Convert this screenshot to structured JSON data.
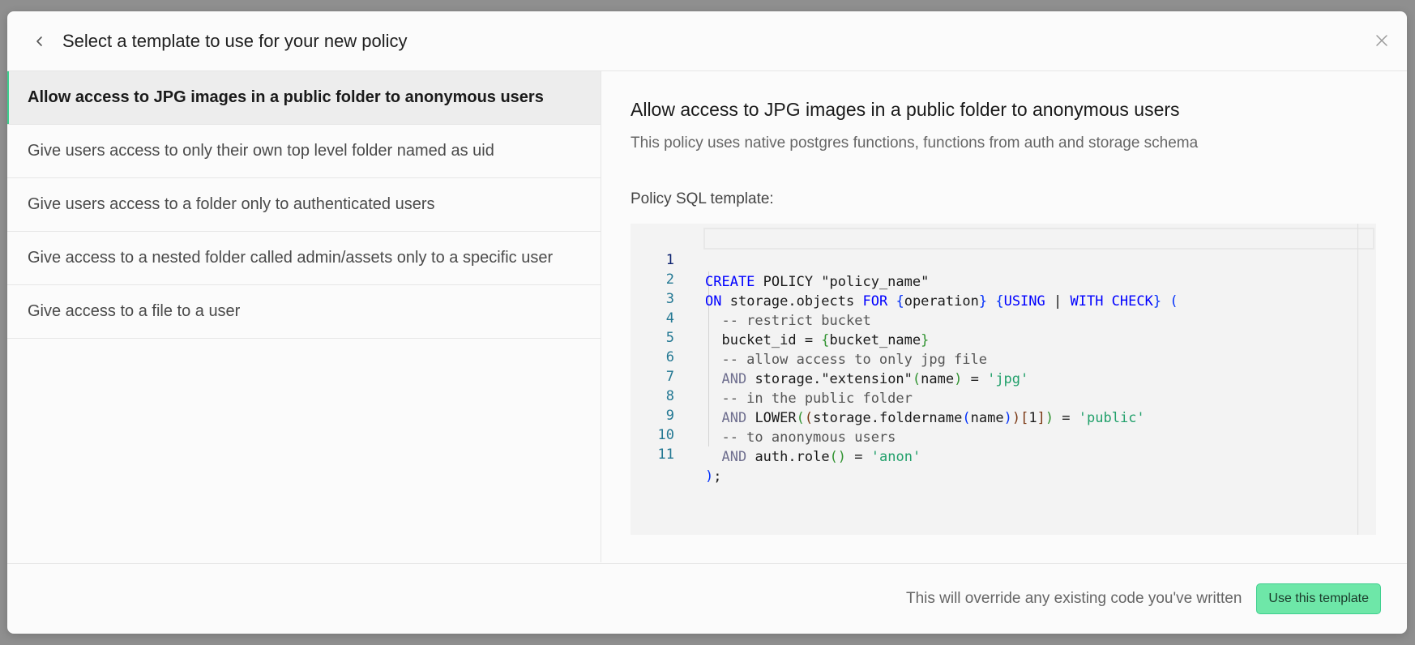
{
  "header": {
    "title": "Select a template to use for your new policy",
    "back_icon": "chevron-left-icon",
    "close_icon": "close-icon"
  },
  "templates": [
    {
      "label": "Allow access to JPG images in a public folder to anonymous users",
      "active": true
    },
    {
      "label": "Give users access to only their own top level folder named as uid",
      "active": false
    },
    {
      "label": "Give users access to a folder only to authenticated users",
      "active": false
    },
    {
      "label": "Give access to a nested folder called admin/assets only to a specific user",
      "active": false
    },
    {
      "label": "Give access to a file to a user",
      "active": false
    }
  ],
  "detail": {
    "title": "Allow access to JPG images in a public folder to anonymous users",
    "description": "This policy uses native postgres functions, functions from auth and storage schema",
    "sql_label": "Policy SQL template:"
  },
  "code_lines": [
    "CREATE POLICY \"policy_name\"",
    "ON storage.objects FOR {operation} {USING | WITH CHECK} (",
    "  -- restrict bucket",
    "  bucket_id = {bucket_name}",
    "  -- allow access to only jpg file",
    "  AND storage.\"extension\"(name) = 'jpg'",
    "  -- in the public folder",
    "  AND LOWER((storage.foldername(name))[1]) = 'public'",
    "  -- to anonymous users",
    "  AND auth.role() = 'anon'",
    ");"
  ],
  "line_numbers": [
    "1",
    "2",
    "3",
    "4",
    "5",
    "6",
    "7",
    "8",
    "9",
    "10",
    "11"
  ],
  "footer": {
    "note": "This will override any existing code you've written",
    "button_label": "Use this template"
  },
  "colors": {
    "accent": "#3ecf8e",
    "button_bg": "#6ee7a8",
    "keyword": "#0000ff",
    "string": "#22a06b",
    "line_number": "#237893"
  }
}
